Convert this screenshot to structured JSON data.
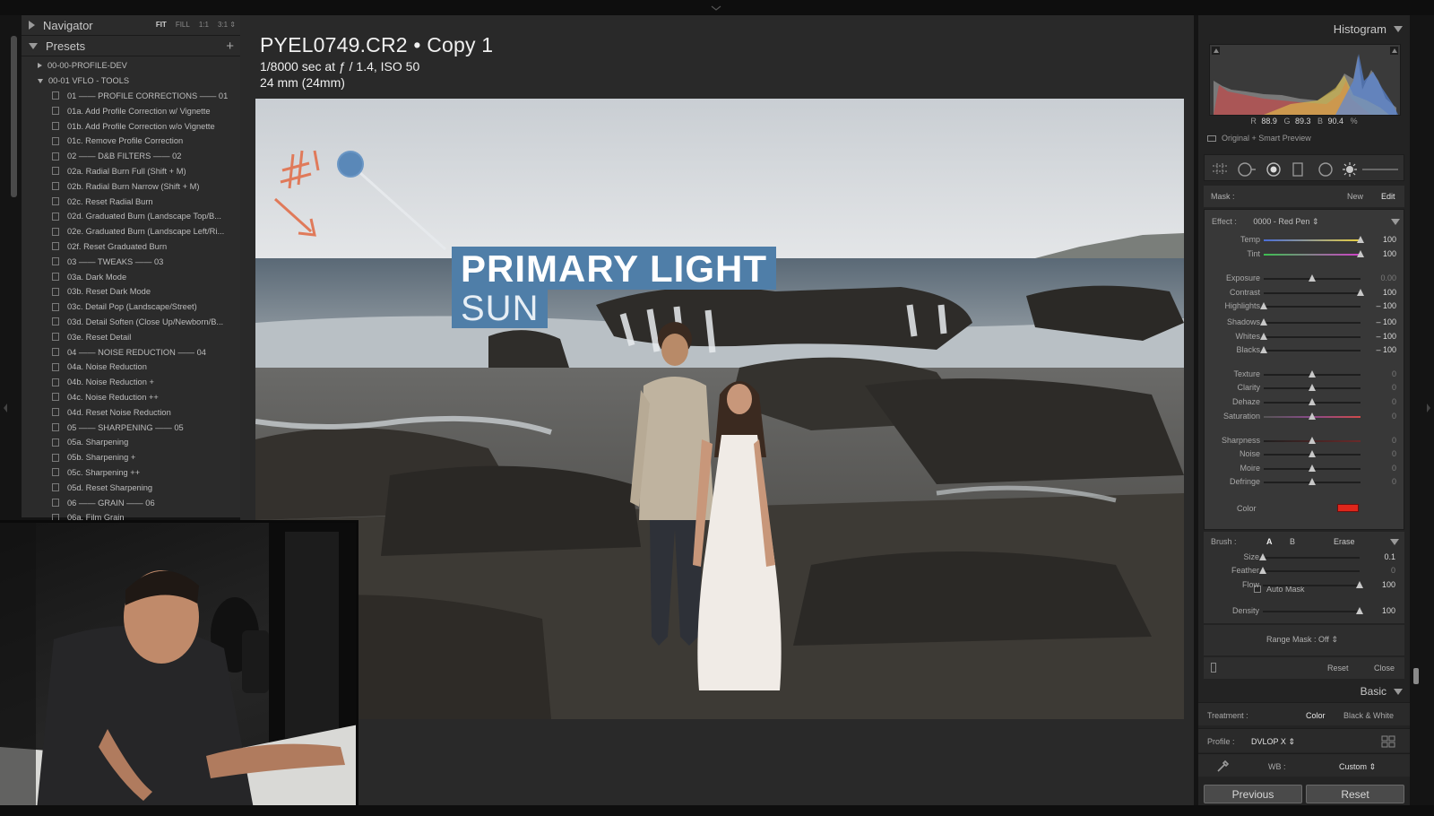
{
  "navigator": {
    "title": "Navigator",
    "modes": [
      "FIT",
      "FILL",
      "1:1",
      "3:1 ⇕"
    ]
  },
  "presets": {
    "title": "Presets",
    "add_label": "+",
    "folders": [
      {
        "name": "00-00-PROFILE-DEV",
        "open": false
      },
      {
        "name": "00-01 VFLO - TOOLS",
        "open": true
      }
    ],
    "items": [
      "01 —— PROFILE CORRECTIONS —— 01",
      "01a. Add Profile Correction w/ Vignette",
      "01b. Add Profile Correction w/o Vignette",
      "01c. Remove Profile Correction",
      "02 —— D&B FILTERS —— 02",
      "02a. Radial Burn Full (Shift + M)",
      "02b. Radial Burn Narrow (Shift + M)",
      "02c. Reset Radial Burn",
      "02d. Graduated Burn (Landscape Top/B...",
      "02e. Graduated Burn (Landscape Left/Ri...",
      "02f. Reset Graduated Burn",
      "03 —— TWEAKS —— 03",
      "03a. Dark Mode",
      "03b. Reset Dark Mode",
      "03c. Detail Pop (Landscape/Street)",
      "03d. Detail Soften (Close Up/Newborn/B...",
      "03e. Reset Detail",
      "04 —— NOISE REDUCTION —— 04",
      "04a. Noise Reduction",
      "04b. Noise Reduction +",
      "04c. Noise Reduction ++",
      "04d. Reset Noise Reduction",
      "05 —— SHARPENING —— 05",
      "05a. Sharpening",
      "05b. Sharpening +",
      "05c. Sharpening ++",
      "05d. Reset Sharpening",
      "06 —— GRAIN —— 06",
      "06a. Film Grain"
    ]
  },
  "photo_info": {
    "filename": "PYEL0749.CR2 • Copy 1",
    "exposure": "1/8000 sec at ƒ / 1.4, ISO 50",
    "focal": "24 mm (24mm)"
  },
  "overlay": {
    "title": "PRIMARY LIGHT",
    "subtitle": "SUN"
  },
  "histogram": {
    "title": "Histogram",
    "r_label": "R",
    "r": "88.9",
    "g_label": "G",
    "g": "89.3",
    "b_label": "B",
    "b": "90.4",
    "unit": "%",
    "preview": "Original + Smart Preview"
  },
  "mask": {
    "label": "Mask :",
    "new": "New",
    "edit": "Edit"
  },
  "effect": {
    "label": "Effect :",
    "value": "0000 - Red Pen ⇕",
    "sliders": [
      {
        "label": "Temp",
        "value": "100",
        "pos": 1.0,
        "dim": false
      },
      {
        "label": "Tint",
        "value": "100",
        "pos": 1.0,
        "dim": false
      },
      {
        "label": "Exposure",
        "value": "0.00",
        "pos": 0.5,
        "dim": true
      },
      {
        "label": "Contrast",
        "value": "100",
        "pos": 1.0,
        "dim": false
      },
      {
        "label": "Highlights",
        "value": "– 100",
        "pos": 0.0,
        "dim": false
      },
      {
        "label": "Shadows",
        "value": "– 100",
        "pos": 0.0,
        "dim": false
      },
      {
        "label": "Whites",
        "value": "– 100",
        "pos": 0.0,
        "dim": false
      },
      {
        "label": "Blacks",
        "value": "– 100",
        "pos": 0.0,
        "dim": false
      },
      {
        "label": "Texture",
        "value": "0",
        "pos": 0.5,
        "dim": true
      },
      {
        "label": "Clarity",
        "value": "0",
        "pos": 0.5,
        "dim": true
      },
      {
        "label": "Dehaze",
        "value": "0",
        "pos": 0.5,
        "dim": true
      },
      {
        "label": "Saturation",
        "value": "0",
        "pos": 0.5,
        "dim": true
      },
      {
        "label": "Sharpness",
        "value": "0",
        "pos": 0.5,
        "dim": true
      },
      {
        "label": "Noise",
        "value": "0",
        "pos": 0.5,
        "dim": true
      },
      {
        "label": "Moire",
        "value": "0",
        "pos": 0.5,
        "dim": true
      },
      {
        "label": "Defringe",
        "value": "0",
        "pos": 0.5,
        "dim": true
      }
    ],
    "color_label": "Color",
    "color_value": "#e0261b"
  },
  "brush": {
    "label": "Brush :",
    "a": "A",
    "b": "B",
    "erase": "Erase",
    "sliders": [
      {
        "label": "Size",
        "value": "0.1",
        "pos": 0.0,
        "dim": false
      },
      {
        "label": "Feather",
        "value": "0",
        "pos": 0.0,
        "dim": true
      },
      {
        "label": "Flow",
        "value": "100",
        "pos": 1.0,
        "dim": false
      },
      {
        "label": "Density",
        "value": "100",
        "pos": 1.0,
        "dim": false
      }
    ],
    "auto_mask": "Auto Mask"
  },
  "range_mask": "Range Mask : Off ⇕",
  "footer": {
    "reset": "Reset",
    "close": "Close"
  },
  "basic": {
    "title": "Basic",
    "treatment_label": "Treatment :",
    "color": "Color",
    "bw": "Black & White",
    "profile_label": "Profile :",
    "profile": "DVLOP X ⇕",
    "wb_label": "WB :",
    "wb": "Custom ⇕"
  },
  "buttons": {
    "previous": "Previous",
    "reset": "Reset"
  }
}
